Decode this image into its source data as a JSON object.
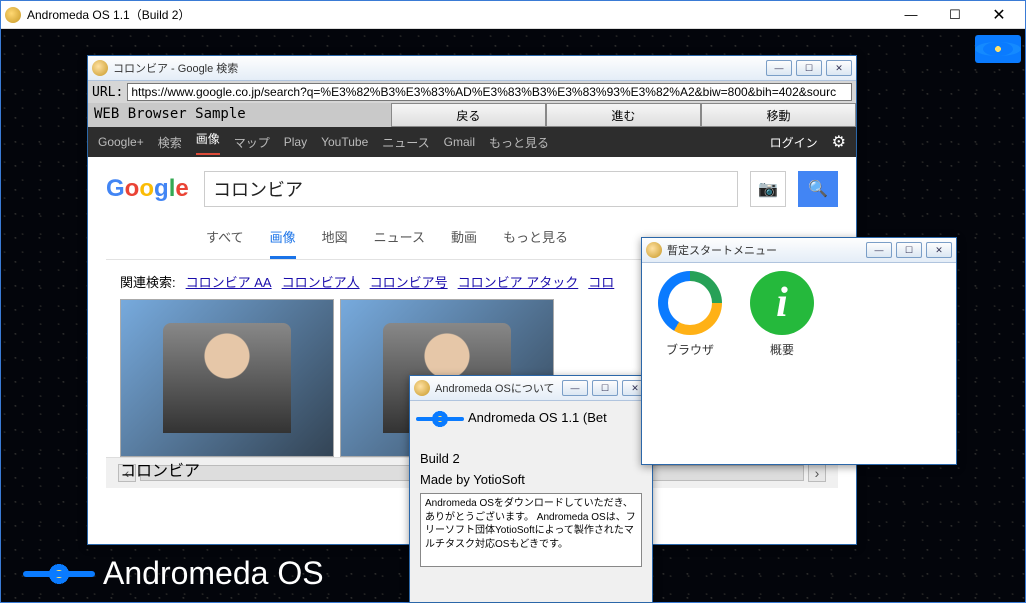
{
  "outer": {
    "title": "Andromeda OS 1.1（Build 2）",
    "min": "—",
    "max": "☐",
    "close": "✕"
  },
  "desktop_logo": "Andromeda OS",
  "browser": {
    "win_title": "コロンビア - Google 検索",
    "min": "—",
    "max": "☐",
    "close": "✕",
    "url_label": "URL:",
    "url_value": "https://www.google.co.jp/search?q=%E3%82%B3%E3%83%AD%E3%83%B3%E3%83%93%E3%82%A2&biw=800&bih=402&sourc",
    "sample_label": "WEB Browser Sample",
    "buttons": {
      "back": "戻る",
      "forward": "進む",
      "move": "移動"
    },
    "google_nav": [
      "Google+",
      "検索",
      "画像",
      "マップ",
      "Play",
      "YouTube",
      "ニュース",
      "Gmail",
      "もっと見る"
    ],
    "login": "ログイン",
    "search_query": "コロンビア",
    "result_tabs": [
      "すべて",
      "画像",
      "地図",
      "ニュース",
      "動画",
      "もっと見る"
    ],
    "related_label": "関連検索:",
    "related_links": [
      "コロンビア AA",
      "コロンビア人",
      "コロンビア号",
      "コロンビア アタック",
      "コロ"
    ],
    "thumb_caption": "コロンビア"
  },
  "about": {
    "win_title": "Andromeda OSについて",
    "min": "—",
    "max": "☐",
    "close": "✕",
    "line1": "Andromeda OS 1.1 (Bet",
    "line2": "Build 2",
    "line3": "Made by YotioSoft",
    "box_text": "Andromeda OSをダウンロードしていただき、ありがとうございます。\nAndromeda OSは、フリーソフト団体YotioSoftによって製作されたマルチタスク対応OSもどきです。"
  },
  "startmenu": {
    "win_title": "暫定スタートメニュー",
    "min": "—",
    "max": "☐",
    "close": "✕",
    "items": [
      {
        "label": "ブラウザ"
      },
      {
        "label": "概要",
        "glyph": "i"
      }
    ]
  }
}
